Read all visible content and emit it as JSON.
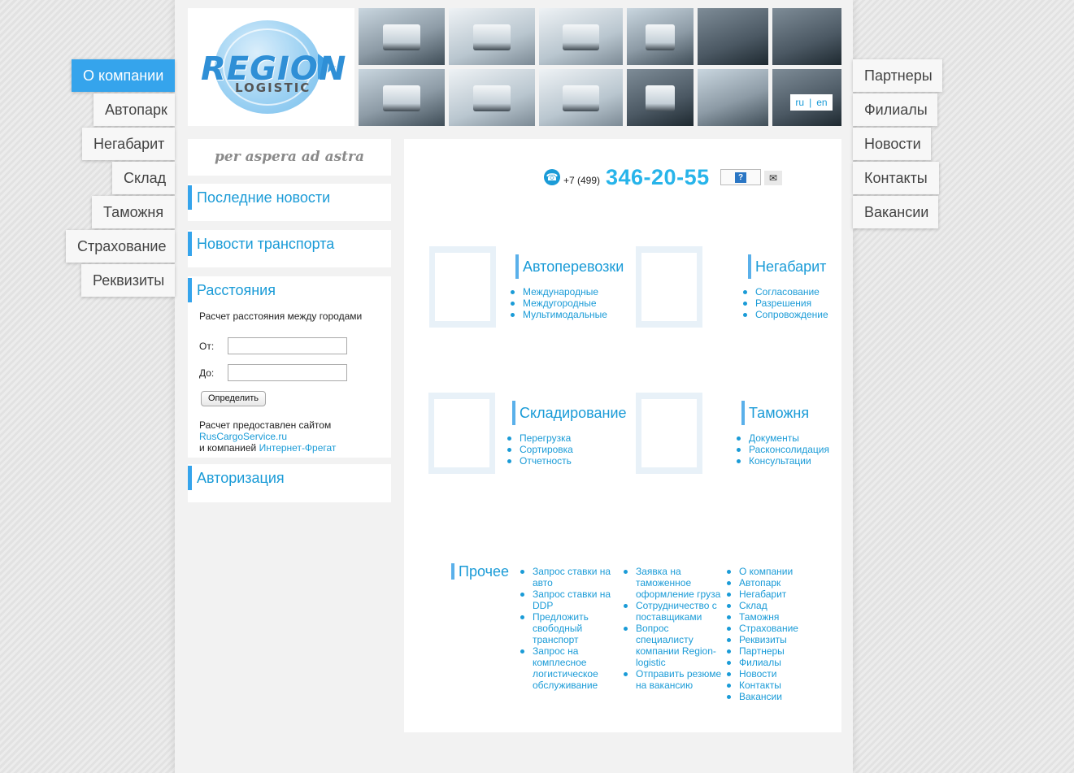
{
  "nav_left": [
    {
      "label": "О компании",
      "active": true
    },
    {
      "label": "Автопарк"
    },
    {
      "label": "Негабарит"
    },
    {
      "label": "Склад"
    },
    {
      "label": "Таможня"
    },
    {
      "label": "Страхование"
    },
    {
      "label": "Реквизиты"
    }
  ],
  "nav_right": [
    {
      "label": "Партнеры"
    },
    {
      "label": "Филиалы"
    },
    {
      "label": "Новости"
    },
    {
      "label": "Контакты"
    },
    {
      "label": "Вакансии"
    }
  ],
  "logo": {
    "word1": "REGION",
    "word2": "LOGISTIC"
  },
  "lang": {
    "ru": "ru",
    "sep": "|",
    "en": "en"
  },
  "motto": "per aspera ad astra",
  "sidebar": {
    "news_latest": "Последние новости",
    "news_transport": "Новости транспорта",
    "distances": {
      "title": "Расстояния",
      "description": "Расчет расстояния между городами",
      "from_label": "От:",
      "from_value": "",
      "to_label": "До:",
      "to_value": "",
      "button": "Определить",
      "credit_line1": "Расчет предоставлен сайтом",
      "credit_site": "RusCargoService.ru",
      "credit_line2": "и компанией",
      "credit_company": "Интернет-Фрегат"
    },
    "auth": "Авторизация"
  },
  "contact": {
    "phone_prefix": "+7 (499)",
    "phone_number": "346-20-55",
    "help_icon": "question-icon",
    "mail_icon": "envelope-icon"
  },
  "services": [
    {
      "title": "Автоперевозки",
      "items": [
        "Международные",
        "Междугородные",
        "Мультимодальные"
      ]
    },
    {
      "title": "Негабарит",
      "items": [
        "Согласование",
        "Разрешения",
        "Сопровождение"
      ]
    },
    {
      "title": "Складирование",
      "items": [
        "Перегрузка",
        "Сортировка",
        "Отчетность"
      ]
    },
    {
      "title": "Таможня",
      "items": [
        "Документы",
        "Расконсолидация",
        "Консультации"
      ]
    }
  ],
  "other": {
    "title": "Прочее",
    "col1": [
      "Запрос ставки на авто",
      "Запрос ставки на DDP",
      "Предложить свободный транспорт",
      "Запрос на комплесное логистическое обслуживание"
    ],
    "col2": [
      "Заявка на таможенное оформление груза",
      "Сотрудничество с поставщиками",
      "Вопрос специалисту компании Region-logistic",
      "Отправить резюме на вакансию"
    ],
    "col3": [
      "О компании",
      "Автопарк",
      "Негабарит",
      "Склад",
      "Таможня",
      "Страхование",
      "Реквизиты",
      "Партнеры",
      "Филиалы",
      "Новости",
      "Контакты",
      "Вакансии"
    ]
  },
  "colors": {
    "accent": "#35a4ec",
    "link": "#1a9bd7",
    "phone": "#27b4ea"
  }
}
